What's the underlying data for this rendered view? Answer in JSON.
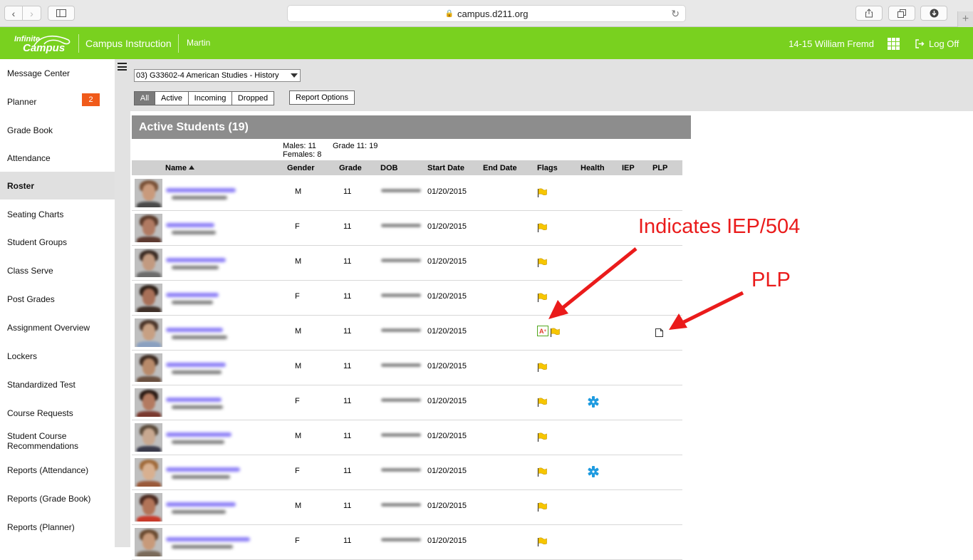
{
  "browser": {
    "url": "campus.d211.org"
  },
  "header": {
    "logo_line1": "Infinite",
    "logo_line2": "Campus",
    "title": "Campus Instruction",
    "subtitle": "Martin",
    "context": "14-15 William Fremd",
    "logoff": "Log Off"
  },
  "sidebar": {
    "items": [
      {
        "label": "Message Center"
      },
      {
        "label": "Planner"
      },
      {
        "label": "Grade Book"
      },
      {
        "label": "Attendance",
        "badge": "2"
      },
      {
        "label": "Roster"
      },
      {
        "label": "Seating Charts"
      },
      {
        "label": "Student Groups"
      },
      {
        "label": "Class Serve"
      },
      {
        "label": "Post Grades"
      },
      {
        "label": "Assignment Overview"
      },
      {
        "label": "Lockers"
      },
      {
        "label": "Standardized Test"
      },
      {
        "label": "Course Requests"
      },
      {
        "label": "Student Course Recommendations"
      },
      {
        "label": "Reports (Attendance)"
      },
      {
        "label": "Reports (Grade Book)"
      },
      {
        "label": "Reports (Planner)"
      }
    ],
    "active": "Roster"
  },
  "toolbar": {
    "course": "03) G33602-4 American Studies - History",
    "filters": [
      "All",
      "Active",
      "Incoming",
      "Dropped"
    ],
    "selected_filter": "All",
    "report_options": "Report Options"
  },
  "roster": {
    "section_title": "Active Students (19)",
    "stats": {
      "males": "Males: 11",
      "females": "Females: 8",
      "grade": "Grade 11: 19"
    },
    "columns": [
      "Name",
      "Gender",
      "Grade",
      "DOB",
      "Start Date",
      "End Date",
      "Flags",
      "Health",
      "IEP",
      "PLP"
    ],
    "sort_column": "Name",
    "sort_direction": "ascending",
    "rows": [
      {
        "gender": "M",
        "grade": "11",
        "start_date": "01/20/2015",
        "flags": [
          "flag"
        ],
        "health": false,
        "plp": false
      },
      {
        "gender": "F",
        "grade": "11",
        "start_date": "01/20/2015",
        "flags": [
          "flag"
        ],
        "health": false,
        "plp": false
      },
      {
        "gender": "M",
        "grade": "11",
        "start_date": "01/20/2015",
        "flags": [
          "flag"
        ],
        "health": false,
        "plp": false
      },
      {
        "gender": "F",
        "grade": "11",
        "start_date": "01/20/2015",
        "flags": [
          "flag"
        ],
        "health": false,
        "plp": false
      },
      {
        "gender": "M",
        "grade": "11",
        "start_date": "01/20/2015",
        "flags": [
          "iep-a-plus",
          "flag"
        ],
        "health": false,
        "plp": true
      },
      {
        "gender": "M",
        "grade": "11",
        "start_date": "01/20/2015",
        "flags": [
          "flag"
        ],
        "health": false,
        "plp": false
      },
      {
        "gender": "F",
        "grade": "11",
        "start_date": "01/20/2015",
        "flags": [
          "flag"
        ],
        "health": true,
        "plp": false
      },
      {
        "gender": "M",
        "grade": "11",
        "start_date": "01/20/2015",
        "flags": [
          "flag"
        ],
        "health": false,
        "plp": false
      },
      {
        "gender": "F",
        "grade": "11",
        "start_date": "01/20/2015",
        "flags": [
          "flag"
        ],
        "health": true,
        "plp": false
      },
      {
        "gender": "M",
        "grade": "11",
        "start_date": "01/20/2015",
        "flags": [
          "flag"
        ],
        "health": false,
        "plp": false
      },
      {
        "gender": "F",
        "grade": "11",
        "start_date": "01/20/2015",
        "flags": [
          "flag"
        ],
        "health": false,
        "plp": false
      }
    ]
  },
  "annotations": {
    "iep": "Indicates IEP/504",
    "plp": "PLP"
  },
  "colors": {
    "header_green": "#79d11f",
    "badge_orange": "#f05a1a",
    "annotation_red": "#ea1b1b",
    "flag_yellow": "#f7c600",
    "health_blue": "#1e9be0"
  }
}
